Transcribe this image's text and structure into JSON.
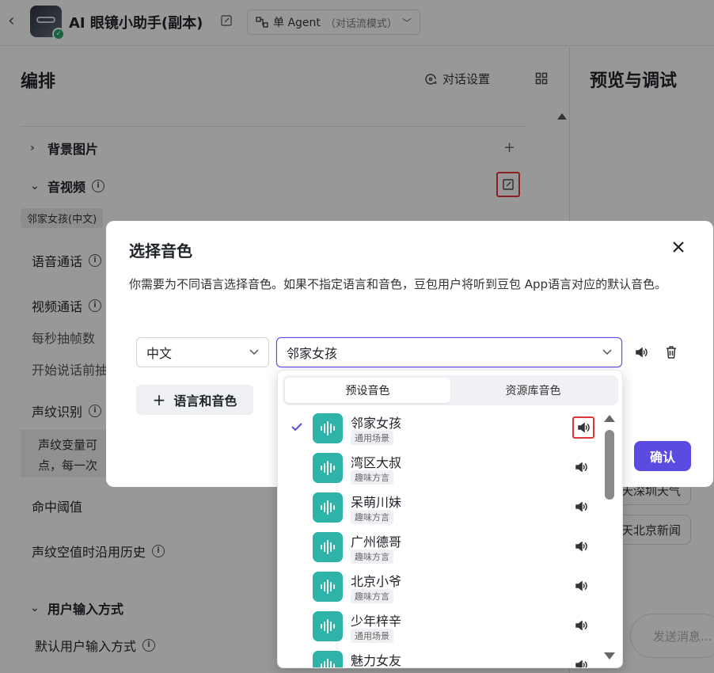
{
  "header": {
    "app_title": "AI 眼镜小助手(副本)",
    "agent_mode": "单 Agent",
    "agent_mode_sub": "（对话流模式）"
  },
  "left_panel": {
    "title": "编排",
    "chat_settings": "对话设置",
    "rows": {
      "background": "背景图片",
      "av": "音视频",
      "voice_tag": "邻家女孩(中文)",
      "voice_call": "语音通话",
      "video_call": "视频通话",
      "fps": "每秒抽帧数",
      "start_speaking": "开始说话前抽",
      "voiceprint": "声纹识别",
      "voiceprint_desc_1": "声纹变量可",
      "voiceprint_desc_2": "点，每一次",
      "hit_threshold": "命中阈值",
      "voiceprint_history": "声纹空值时沿用历史",
      "user_input": "用户输入方式",
      "default_input": "默认用户输入方式"
    }
  },
  "right_panel": {
    "title": "预览与调试",
    "chip_1": "天深圳天气",
    "chip_2": "天北京新闻",
    "send_placeholder": "发送消息..."
  },
  "modal": {
    "title": "选择音色",
    "description": "你需要为不同语言选择音色。如果不指定语言和音色，豆包用户将听到豆包 App语言对应的默认音色。",
    "language_value": "中文",
    "voice_value": "邻家女孩",
    "add_button": "语言和音色",
    "confirm_button": "确认"
  },
  "dropdown": {
    "tabs": [
      "预设音色",
      "资源库音色"
    ],
    "active_tab": 0,
    "items": [
      {
        "name": "邻家女孩",
        "tag": "通用场景",
        "selected": true
      },
      {
        "name": "湾区大叔",
        "tag": "趣味方言",
        "selected": false
      },
      {
        "name": "呆萌川妹",
        "tag": "趣味方言",
        "selected": false
      },
      {
        "name": "广州德哥",
        "tag": "趣味方言",
        "selected": false
      },
      {
        "name": "北京小爷",
        "tag": "趣味方言",
        "selected": false
      },
      {
        "name": "少年梓辛",
        "tag": "通用场景",
        "selected": false
      },
      {
        "name": "魅力女友",
        "tag": "",
        "selected": false
      }
    ]
  },
  "colors": {
    "accent": "#5b4be0",
    "avatar_teal": "#2db3a8",
    "highlight_red": "#e0353a"
  }
}
